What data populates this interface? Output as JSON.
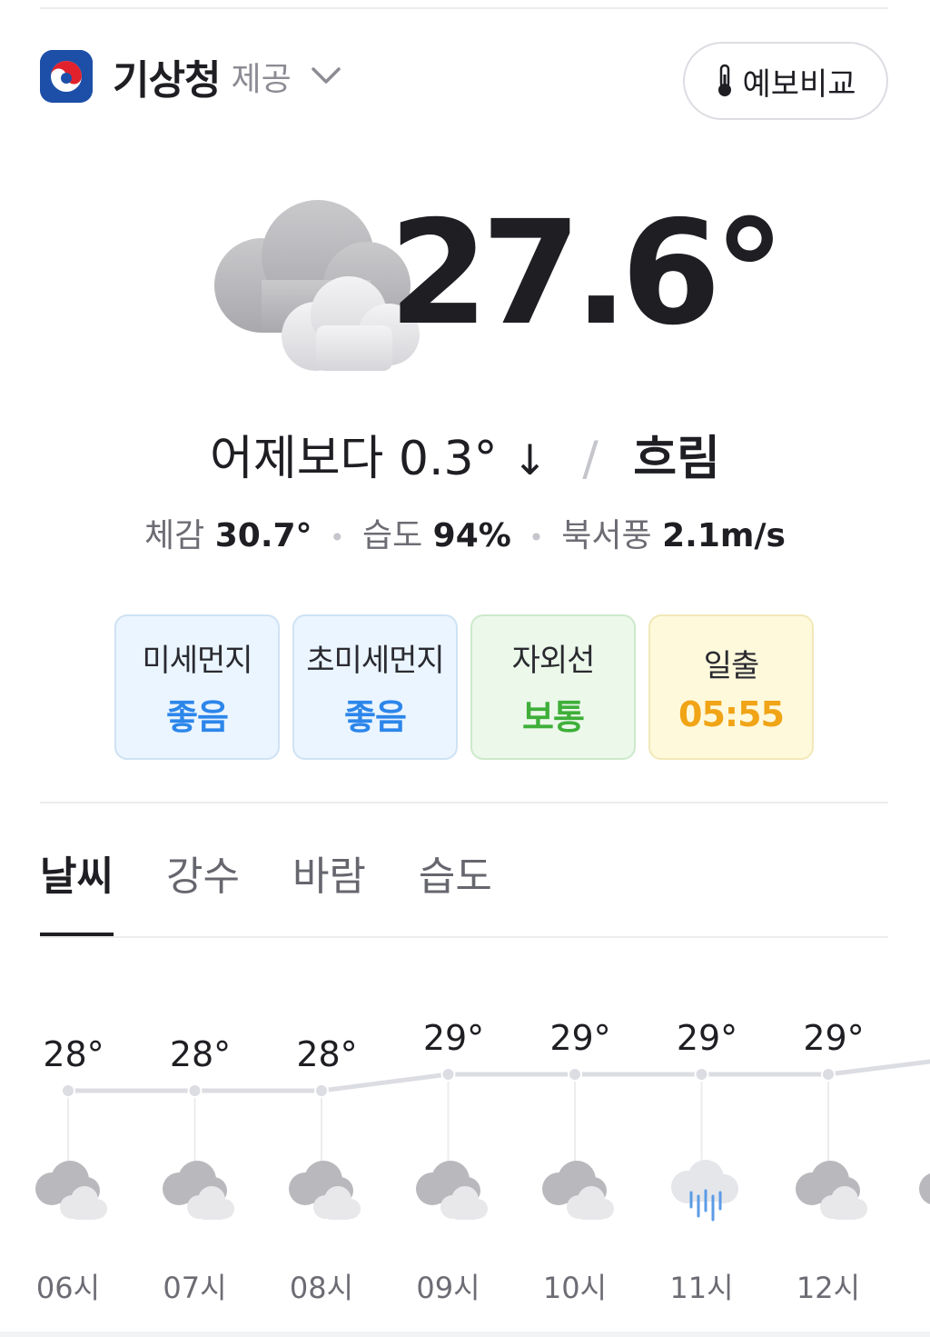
{
  "header": {
    "provider_name": "기상청",
    "provider_suffix": "제공",
    "compare_button": "예보비교",
    "brand_color": "#1d4fa8"
  },
  "current": {
    "temperature": "27.6°",
    "compare_text": "어제보다 0.3°",
    "compare_direction": "↓",
    "condition": "흐림",
    "feels_like_label": "체감",
    "feels_like_value": "30.7°",
    "humidity_label": "습도",
    "humidity_value": "94%",
    "wind_label": "북서풍",
    "wind_value": "2.1m/s"
  },
  "badges": [
    {
      "title": "미세먼지",
      "value": "좋음",
      "color": "#2c86ea"
    },
    {
      "title": "초미세먼지",
      "value": "좋음",
      "color": "#2c86ea"
    },
    {
      "title": "자외선",
      "value": "보통",
      "color": "#3faf3a"
    },
    {
      "title": "일출",
      "value": "05:55",
      "color": "#f0a416"
    }
  ],
  "tabs": [
    {
      "label": "날씨",
      "active": true
    },
    {
      "label": "강수",
      "active": false
    },
    {
      "label": "바람",
      "active": false
    },
    {
      "label": "습도",
      "active": false
    }
  ],
  "hourly": [
    {
      "time": "06시",
      "temp": "28°",
      "icon": "cloudy-icon"
    },
    {
      "time": "07시",
      "temp": "28°",
      "icon": "cloudy-icon"
    },
    {
      "time": "08시",
      "temp": "28°",
      "icon": "cloudy-icon"
    },
    {
      "time": "09시",
      "temp": "29°",
      "icon": "cloudy-icon"
    },
    {
      "time": "10시",
      "temp": "29°",
      "icon": "cloudy-icon"
    },
    {
      "time": "11시",
      "temp": "29°",
      "icon": "rain-icon"
    },
    {
      "time": "12시",
      "temp": "29°",
      "icon": "cloudy-icon"
    }
  ]
}
